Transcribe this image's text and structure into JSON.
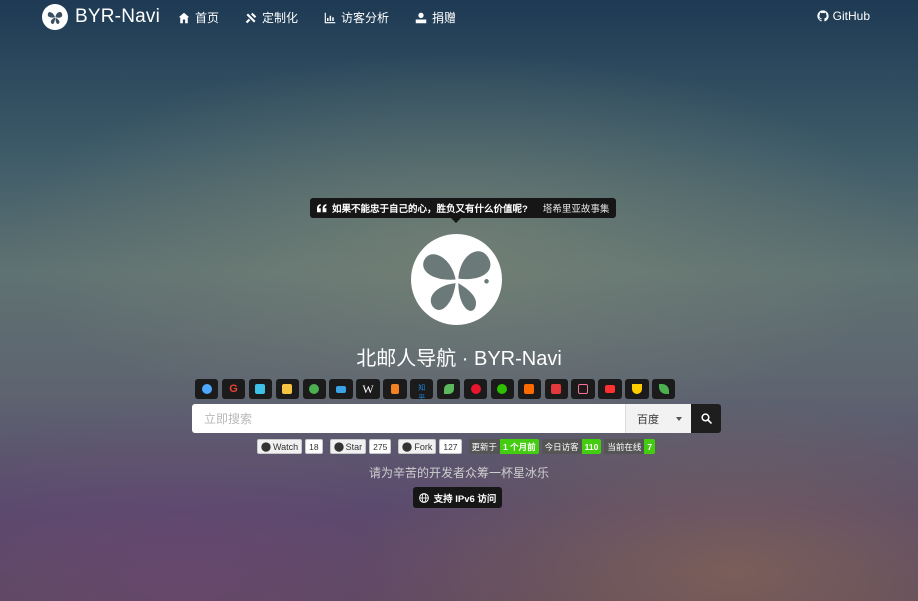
{
  "brand": {
    "name": "BYR-Navi"
  },
  "nav": {
    "items": [
      {
        "label": "首页",
        "icon": "home-icon"
      },
      {
        "label": "定制化",
        "icon": "tools-icon"
      },
      {
        "label": "访客分析",
        "icon": "chart-icon"
      },
      {
        "label": "捐赠",
        "icon": "donate-icon"
      }
    ],
    "github_label": "GitHub"
  },
  "quote": {
    "text": "如果不能忠于自己的心，胜负又有什么价值呢?",
    "source": "塔希里亚故事集"
  },
  "title": "北邮人导航 · BYR-Navi",
  "quick_links": [
    {
      "icon": "baidu-icon",
      "color": "#4ea8ff"
    },
    {
      "icon": "google-icon",
      "color": "#ea4335"
    },
    {
      "icon": "bing-icon",
      "color": "#3ec1e6"
    },
    {
      "icon": "byr-icon",
      "color": "#f6c342"
    },
    {
      "icon": "qiyi-icon",
      "color": "#4caf50"
    },
    {
      "icon": "card-icon",
      "color": "#39a3e6"
    },
    {
      "icon": "wikipedia-icon",
      "color": "#ffffff"
    },
    {
      "icon": "stackoverflow-icon",
      "color": "#f48024"
    },
    {
      "icon": "zhihu-icon",
      "color": "#1e88e5"
    },
    {
      "icon": "sprout-icon",
      "color": "#5cb85c"
    },
    {
      "icon": "weibo-icon",
      "color": "#e6162d"
    },
    {
      "icon": "wechat-icon",
      "color": "#2dc100"
    },
    {
      "icon": "taobao-cart-icon",
      "color": "#ff6a00"
    },
    {
      "icon": "jd-cart-icon",
      "color": "#e4393c"
    },
    {
      "icon": "bilibili-icon",
      "color": "#fb7299"
    },
    {
      "icon": "youtube-icon",
      "color": "#ff3030"
    },
    {
      "icon": "magnet-icon",
      "color": "#ffcc00"
    },
    {
      "icon": "leaf-icon",
      "color": "#4caf50"
    }
  ],
  "search": {
    "placeholder": "立即搜索",
    "engine": "百度"
  },
  "badges": {
    "watch_label": "Watch",
    "watch_count": "18",
    "star_label": "Star",
    "star_count": "275",
    "fork_label": "Fork",
    "fork_count": "127",
    "updated_label": "更新于",
    "updated_value": "1 个月前",
    "today_label": "今日访客",
    "today_value": "110",
    "online_label": "当前在线",
    "online_value": "7"
  },
  "donate_text": "请为辛苦的开发者众筹一杯星冰乐",
  "ipv6_label": "支持 IPv6 访问"
}
